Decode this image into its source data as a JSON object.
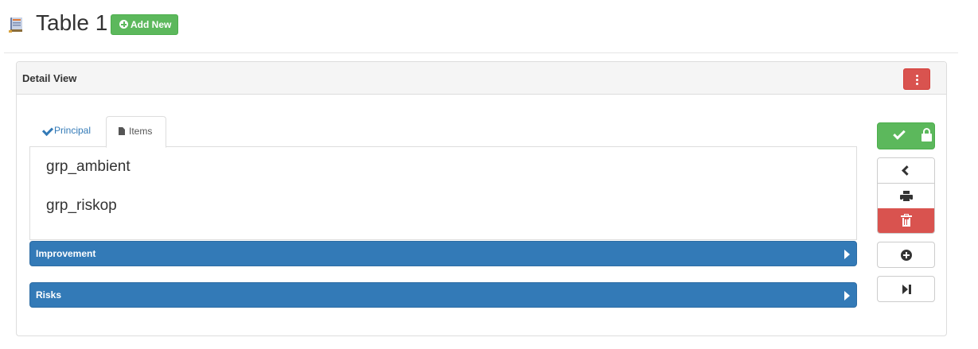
{
  "header": {
    "title": "Table 1",
    "add_new_label": "Add New",
    "icon": "table-book-icon"
  },
  "panel": {
    "title": "Detail View",
    "menu_icon": "vertical-ellipsis-icon"
  },
  "tabs": [
    {
      "label": "Principal",
      "icon": "check-icon",
      "active": false
    },
    {
      "label": "Items",
      "icon": "file-icon",
      "active": true
    }
  ],
  "items": [
    "grp_ambient",
    "grp_riskop"
  ],
  "sections": [
    {
      "label": "Improvement",
      "icon": "caret-right-icon"
    },
    {
      "label": "Risks",
      "icon": "caret-right-icon"
    }
  ],
  "side_actions": {
    "save_icon": "check-icon",
    "lock_icon": "lock-icon",
    "prev_icon": "chevron-left-icon",
    "print_icon": "printer-icon",
    "delete_icon": "trash-icon",
    "new_icon": "plus-circle-icon",
    "last_icon": "step-forward-icon"
  },
  "colors": {
    "success": "#5cb85c",
    "danger": "#d9534f",
    "primary": "#337ab7"
  }
}
